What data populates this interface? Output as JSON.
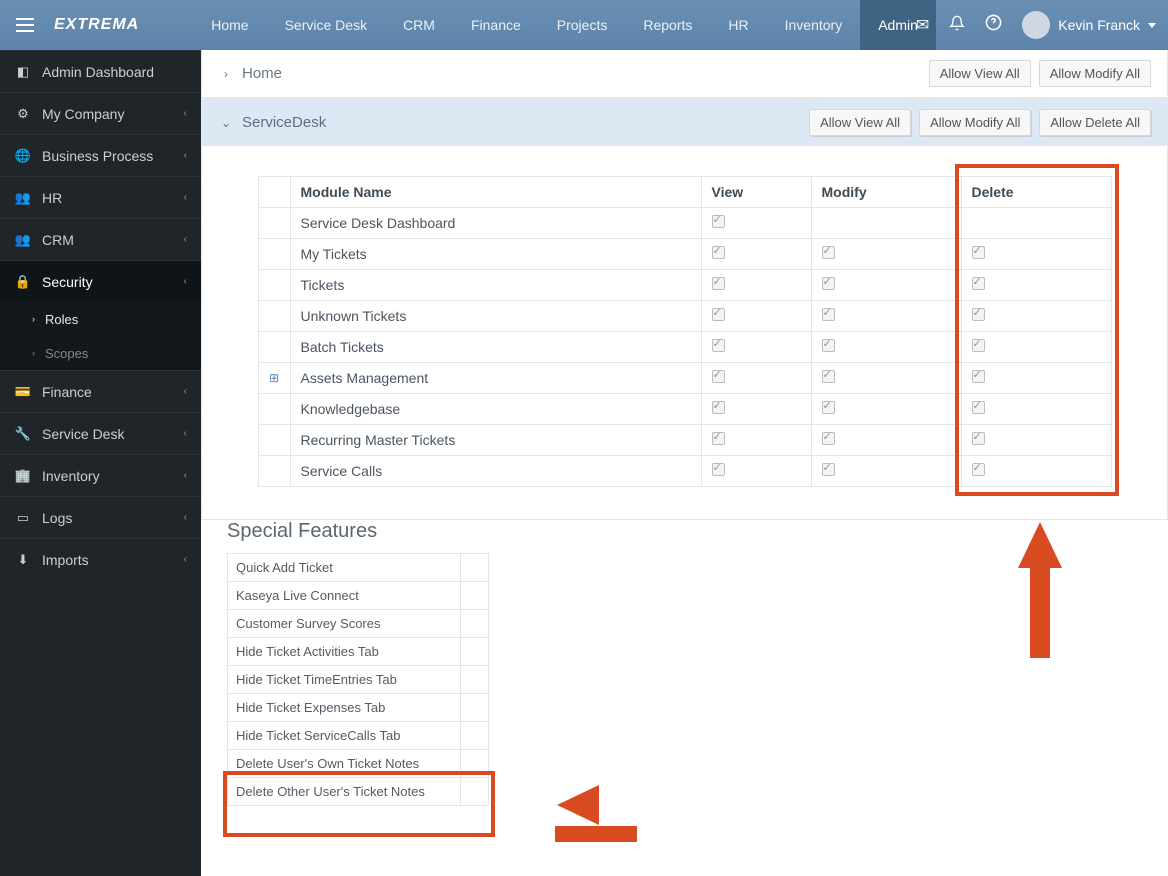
{
  "brand": "EXTREMA",
  "topnav": {
    "items": [
      {
        "label": "Home"
      },
      {
        "label": "Service Desk"
      },
      {
        "label": "CRM"
      },
      {
        "label": "Finance"
      },
      {
        "label": "Projects"
      },
      {
        "label": "Reports"
      },
      {
        "label": "HR"
      },
      {
        "label": "Inventory"
      },
      {
        "label": "Admin"
      }
    ],
    "active_index": 8
  },
  "user": {
    "name": "Kevin Franck"
  },
  "sidebar": {
    "items": [
      {
        "label": "Admin Dashboard",
        "icon": "dashboard-icon"
      },
      {
        "label": "My Company",
        "icon": "gear-icon",
        "expandable": true
      },
      {
        "label": "Business Process",
        "icon": "globe-icon",
        "expandable": true
      },
      {
        "label": "HR",
        "icon": "users-icon",
        "expandable": true
      },
      {
        "label": "CRM",
        "icon": "users-icon",
        "expandable": true
      },
      {
        "label": "Security",
        "icon": "lock-icon",
        "expandable": true,
        "active": true
      },
      {
        "label": "Finance",
        "icon": "card-icon",
        "expandable": true
      },
      {
        "label": "Service Desk",
        "icon": "wrench-icon",
        "expandable": true
      },
      {
        "label": "Inventory",
        "icon": "building-icon",
        "expandable": true
      },
      {
        "label": "Logs",
        "icon": "terminal-icon",
        "expandable": true
      },
      {
        "label": "Imports",
        "icon": "download-icon",
        "expandable": true
      }
    ],
    "security_sub": [
      {
        "label": "Roles",
        "selected": true
      },
      {
        "label": "Scopes",
        "selected": false
      }
    ]
  },
  "panels": {
    "home": {
      "title": "Home",
      "actions": [
        "Allow View All",
        "Allow Modify All"
      ]
    },
    "servicedesk": {
      "title": "ServiceDesk",
      "actions": [
        "Allow View All",
        "Allow Modify All",
        "Allow Delete All"
      ]
    }
  },
  "perm_table": {
    "headers": {
      "module": "Module Name",
      "view": "View",
      "modify": "Modify",
      "delete": "Delete"
    },
    "rows": [
      {
        "name": "Service Desk Dashboard",
        "view": true,
        "modify": null,
        "delete": null
      },
      {
        "name": "My Tickets",
        "view": true,
        "modify": true,
        "delete": true
      },
      {
        "name": "Tickets",
        "view": true,
        "modify": true,
        "delete": true
      },
      {
        "name": "Unknown Tickets",
        "view": true,
        "modify": true,
        "delete": true
      },
      {
        "name": "Batch Tickets",
        "view": true,
        "modify": true,
        "delete": true
      },
      {
        "name": "Assets Management",
        "view": true,
        "modify": true,
        "delete": true,
        "expand": true
      },
      {
        "name": "Knowledgebase",
        "view": true,
        "modify": true,
        "delete": true
      },
      {
        "name": "Recurring Master Tickets",
        "view": true,
        "modify": true,
        "delete": true
      },
      {
        "name": "Service Calls",
        "view": true,
        "modify": true,
        "delete": true
      }
    ]
  },
  "special": {
    "title": "Special Features",
    "rows": [
      {
        "name": "Quick Add Ticket",
        "checked": true
      },
      {
        "name": "Kaseya Live Connect",
        "checked": true
      },
      {
        "name": "Customer Survey Scores",
        "checked": true
      },
      {
        "name": "Hide Ticket Activities Tab",
        "checked": false
      },
      {
        "name": "Hide Ticket TimeEntries Tab",
        "checked": false
      },
      {
        "name": "Hide Ticket Expenses Tab",
        "checked": false
      },
      {
        "name": "Hide Ticket ServiceCalls Tab",
        "checked": false
      },
      {
        "name": "Delete User's Own Ticket Notes",
        "checked": true
      },
      {
        "name": "Delete Other User's Ticket Notes",
        "checked": true
      }
    ]
  }
}
